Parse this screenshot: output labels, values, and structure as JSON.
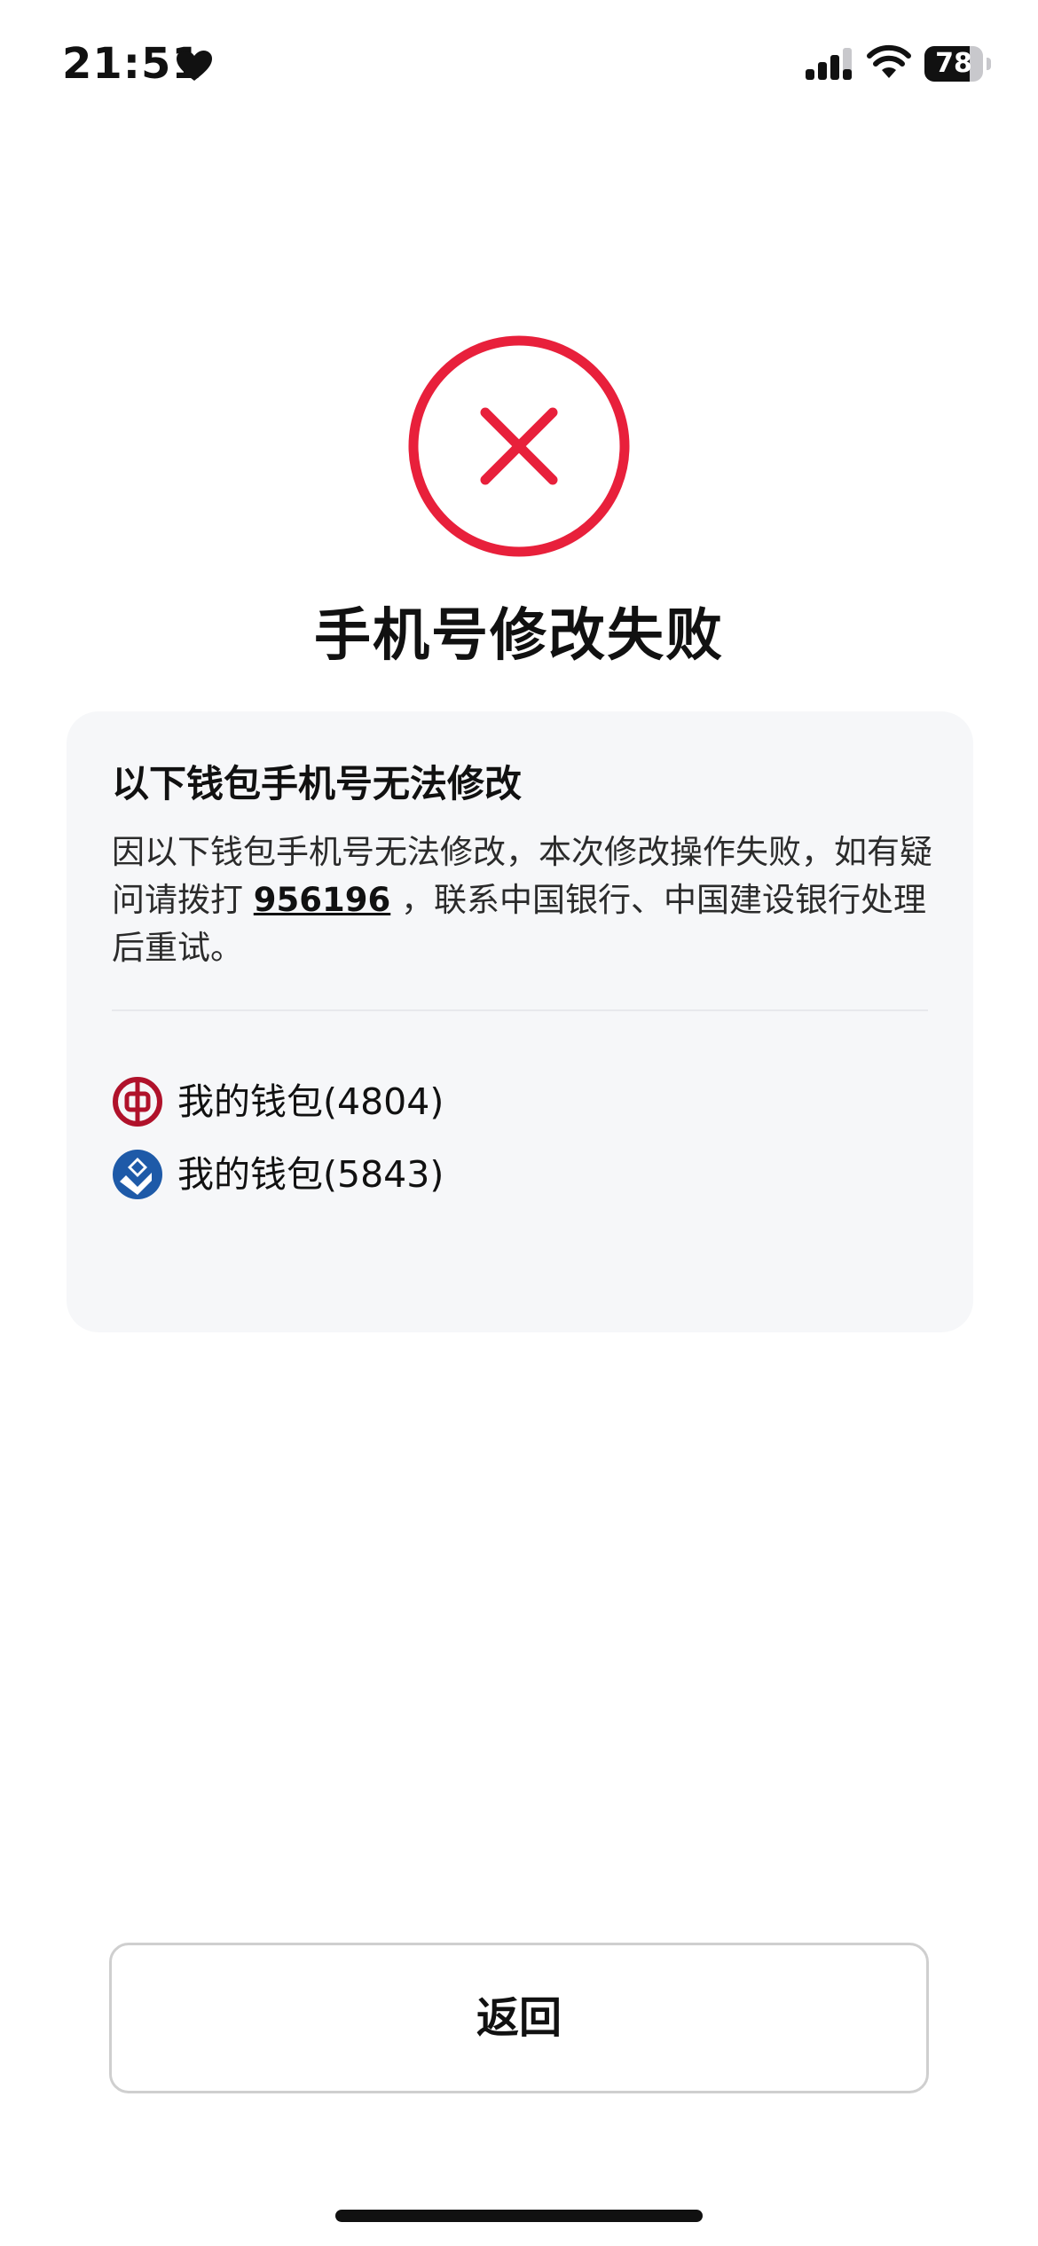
{
  "status_bar": {
    "time": "21:51",
    "battery_level": "78",
    "battery_fraction": 0.78
  },
  "colors": {
    "error_red": "#e8203b",
    "card_background": "#f6f7f9",
    "boc_red": "#b0122b",
    "ccb_blue": "#1e5aa8"
  },
  "result": {
    "icon": "close-icon",
    "title": "手机号修改失败"
  },
  "card": {
    "title": "以下钱包手机号无法修改",
    "description_before": "因以下钱包手机号无法修改，本次修改操作失败，如有疑问请拨打 ",
    "phone_number": "956196",
    "description_after": " ，联系中国银行、中国建设银行处理后重试。",
    "wallets": [
      {
        "icon": "bank-of-china-icon",
        "label": "我的钱包(4804)"
      },
      {
        "icon": "china-construction-bank-icon",
        "label": "我的钱包(5843)"
      }
    ]
  },
  "footer": {
    "back_label": "返回"
  }
}
